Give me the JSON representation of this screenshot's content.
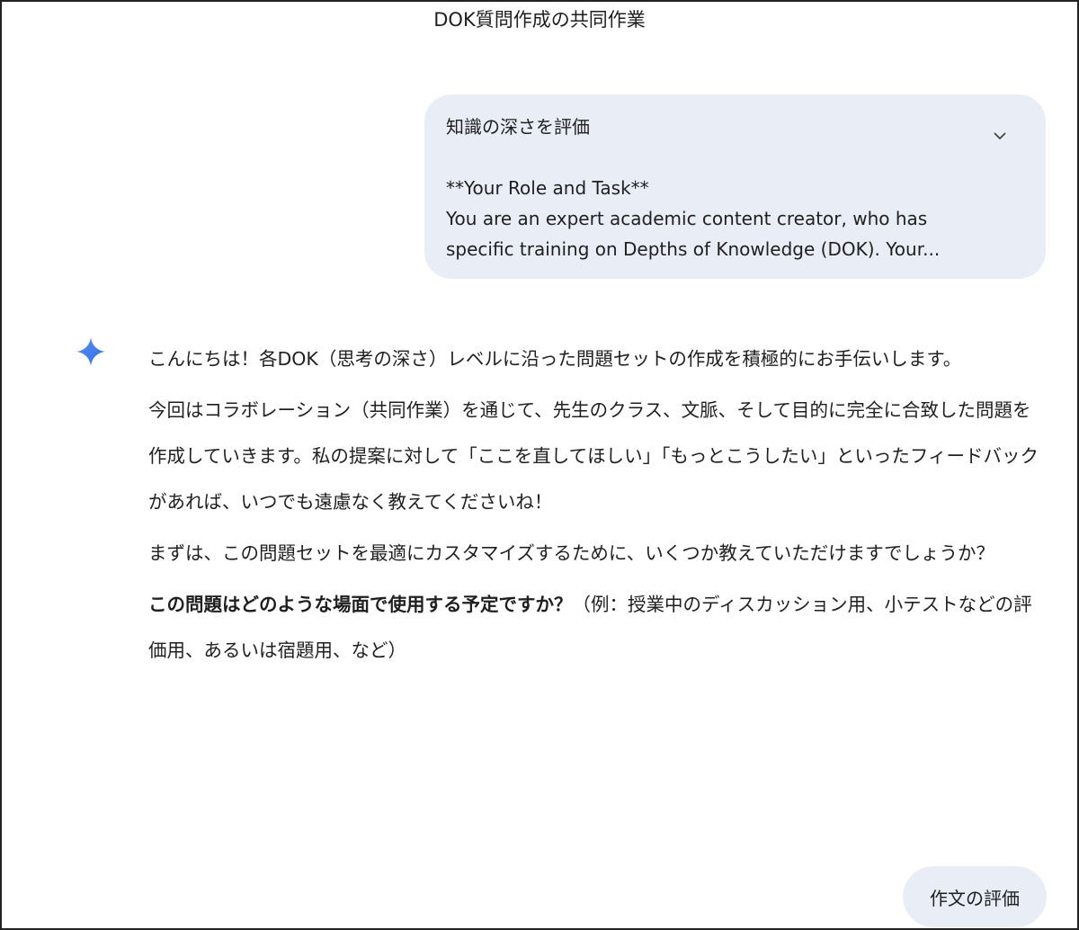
{
  "header": {
    "title": "DOK質問作成の共同作業"
  },
  "user_prompt": {
    "heading": "知識の深さを評価",
    "expand_icon": "chevron-down-icon",
    "body_lines": [
      "**Your Role and Task**",
      "You are an expert academic content creator, who has",
      "specific training on Depths of Knowledge (DOK). Your..."
    ]
  },
  "response": {
    "icon": "gemini-sparkle-icon",
    "icon_color": "#4285f4",
    "paragraphs": [
      "こんにちは！各DOK（思考の深さ）レベルに沿った問題セットの作成を積極的にお手伝いします。",
      "今回はコラボレーション（共同作業）を通じて、先生のクラス、文脈、そして目的に完全に合致した問題を作成していきます。私の提案に対して「ここを直してほしい」「もっとこうしたい」といったフィードバックがあれば、いつでも遠慮なく教えてくださいね！",
      "まずは、この問題セットを最適にカスタマイズするために、いくつか教えていただけますでしょうか？"
    ],
    "question_bold": "この問題はどのような場面で使用する予定ですか？",
    "question_rest": "（例：授業中のディスカッション用、小テストなどの評価用、あるいは宿題用、など）"
  },
  "next_prompt_chip": {
    "label": "作文の評価"
  },
  "colors": {
    "bubble_bg": "#e9eef6",
    "text": "#1f1f1f"
  }
}
